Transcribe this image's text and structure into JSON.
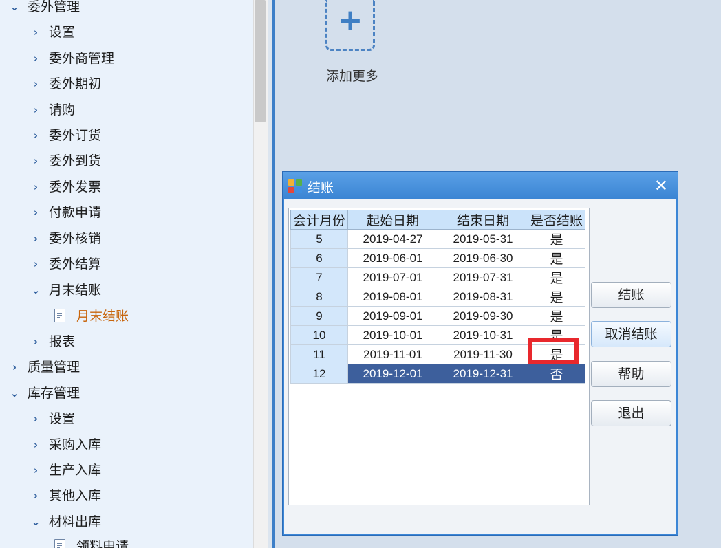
{
  "sidebar": {
    "items": [
      {
        "label": "委外管理",
        "expanded": true
      },
      {
        "label": "设置"
      },
      {
        "label": "委外商管理"
      },
      {
        "label": "委外期初"
      },
      {
        "label": "请购"
      },
      {
        "label": "委外订货"
      },
      {
        "label": "委外到货"
      },
      {
        "label": "委外发票"
      },
      {
        "label": "付款申请"
      },
      {
        "label": "委外核销"
      },
      {
        "label": "委外结算"
      },
      {
        "label": "月末结账",
        "expanded": true
      },
      {
        "label": "月末结账",
        "active": true
      },
      {
        "label": "报表"
      },
      {
        "label": "质量管理"
      },
      {
        "label": "库存管理",
        "expanded": true
      },
      {
        "label": "设置"
      },
      {
        "label": "采购入库"
      },
      {
        "label": "生产入库"
      },
      {
        "label": "其他入库"
      },
      {
        "label": "材料出库",
        "expanded": true
      },
      {
        "label": "领料申请"
      }
    ]
  },
  "main": {
    "add_more_label": "添加更多",
    "add_icon": "plus-icon"
  },
  "dialog": {
    "title": "结账",
    "close_icon": "close-icon",
    "columns": [
      "会计月份",
      "起始日期",
      "结束日期",
      "是否结账"
    ],
    "rows": [
      {
        "month": "5",
        "start": "2019-04-27",
        "end": "2019-05-31",
        "closed": "是"
      },
      {
        "month": "6",
        "start": "2019-06-01",
        "end": "2019-06-30",
        "closed": "是"
      },
      {
        "month": "7",
        "start": "2019-07-01",
        "end": "2019-07-31",
        "closed": "是"
      },
      {
        "month": "8",
        "start": "2019-08-01",
        "end": "2019-08-31",
        "closed": "是"
      },
      {
        "month": "9",
        "start": "2019-09-01",
        "end": "2019-09-30",
        "closed": "是"
      },
      {
        "month": "10",
        "start": "2019-10-01",
        "end": "2019-10-31",
        "closed": "是"
      },
      {
        "month": "11",
        "start": "2019-11-01",
        "end": "2019-11-30",
        "closed": "是"
      },
      {
        "month": "12",
        "start": "2019-12-01",
        "end": "2019-12-31",
        "closed": "否"
      }
    ],
    "selected_month": "12",
    "buttons": {
      "close_account": "结账",
      "cancel_close": "取消结账",
      "help": "帮助",
      "exit": "退出"
    }
  },
  "colors": {
    "dialog_title": "#3a84d3",
    "selected_row": "#3d5f9c",
    "highlight": "#e8282d",
    "active_menu": "#c8660e"
  }
}
